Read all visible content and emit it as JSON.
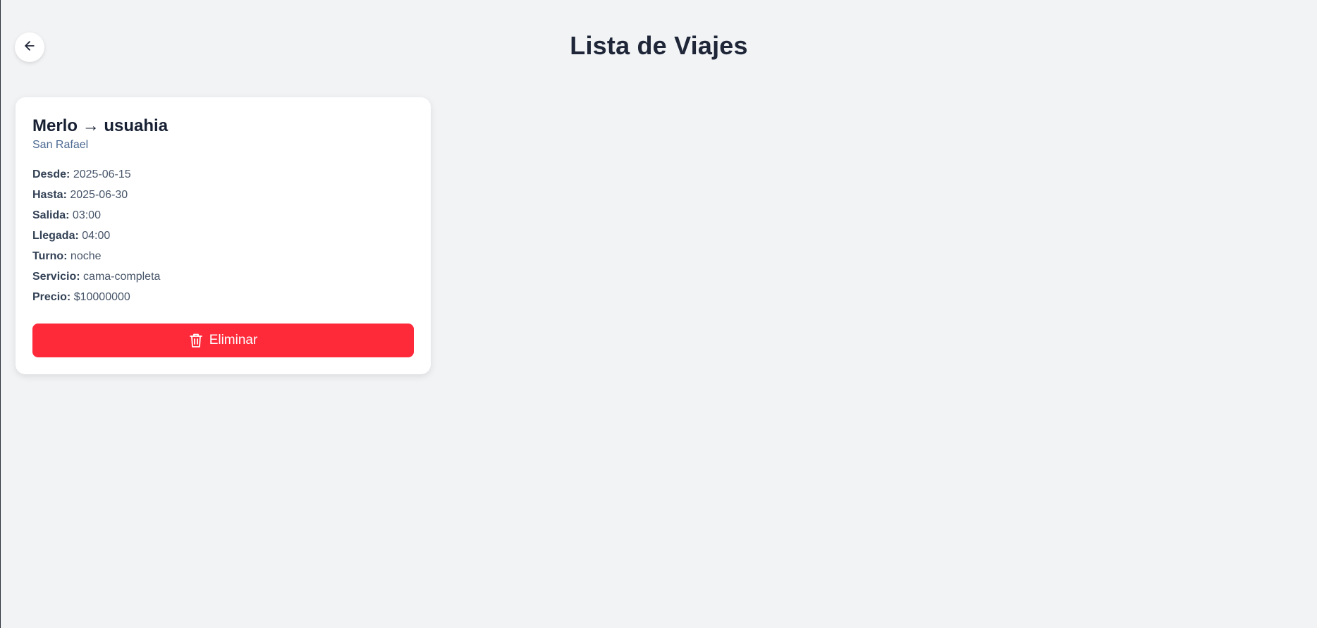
{
  "header": {
    "title": "Lista de Viajes",
    "back_icon": "arrow-left-icon"
  },
  "trips": [
    {
      "origin": "Merlo",
      "arrow": "→",
      "destination": "usuahia",
      "company": "San Rafael",
      "fields": {
        "desde_label": "Desde:",
        "desde": "2025-06-15",
        "hasta_label": "Hasta:",
        "hasta": "2025-06-30",
        "salida_label": "Salida:",
        "salida": "03:00",
        "llegada_label": "Llegada:",
        "llegada": "04:00",
        "turno_label": "Turno:",
        "turno": "noche",
        "servicio_label": "Servicio:",
        "servicio": "cama-completa",
        "precio_label": "Precio:",
        "precio": "$10000000"
      },
      "delete_label": "Eliminar",
      "delete_icon": "trash-icon"
    }
  ],
  "colors": {
    "background": "#f2f3f5",
    "danger": "#fe2a3a",
    "title": "#1f2638",
    "company": "#4d6a93"
  }
}
